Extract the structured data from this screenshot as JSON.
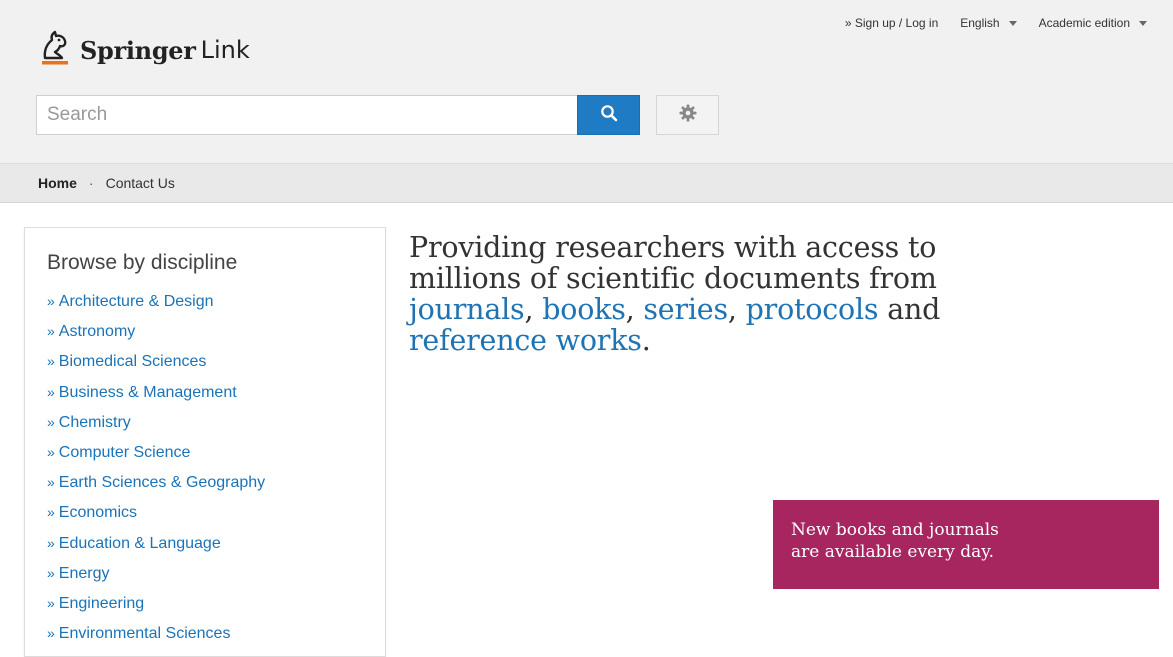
{
  "header": {
    "logo_brand": "Springer",
    "logo_product": "Link",
    "top_links": {
      "sign_up": "» Sign up / Log in",
      "language": "English",
      "edition": "Academic edition"
    },
    "search": {
      "placeholder": "Search"
    },
    "icons": {
      "search_button": "search-icon",
      "preferences_button": "gear-icon",
      "logo": "knight-icon"
    }
  },
  "breadcrumb": {
    "home": "Home",
    "separator": "·",
    "contact": "Contact Us"
  },
  "browse": {
    "title": "Browse by discipline",
    "prefix": "»",
    "items": [
      "Architecture & Design",
      "Astronomy",
      "Biomedical Sciences",
      "Business & Management",
      "Chemistry",
      "Computer Science",
      "Earth Sciences & Geography",
      "Economics",
      "Education & Language",
      "Energy",
      "Engineering",
      "Environmental Sciences"
    ]
  },
  "hero": {
    "line1": "Providing researchers with access to",
    "line2": "millions of scientific documents from",
    "link_journals": "journals",
    "link_books": "books",
    "link_series": "series",
    "link_protocols": "protocols",
    "and": "and",
    "link_reference": "reference works",
    "comma": ",",
    "period": "."
  },
  "promo": {
    "line1": "New books and journals",
    "line2": "are available every day."
  },
  "colors": {
    "accent_blue": "#1e7bc4",
    "link_blue": "#1a73b8",
    "promo_magenta": "#a7265f",
    "logo_underline": "#e8731a"
  }
}
